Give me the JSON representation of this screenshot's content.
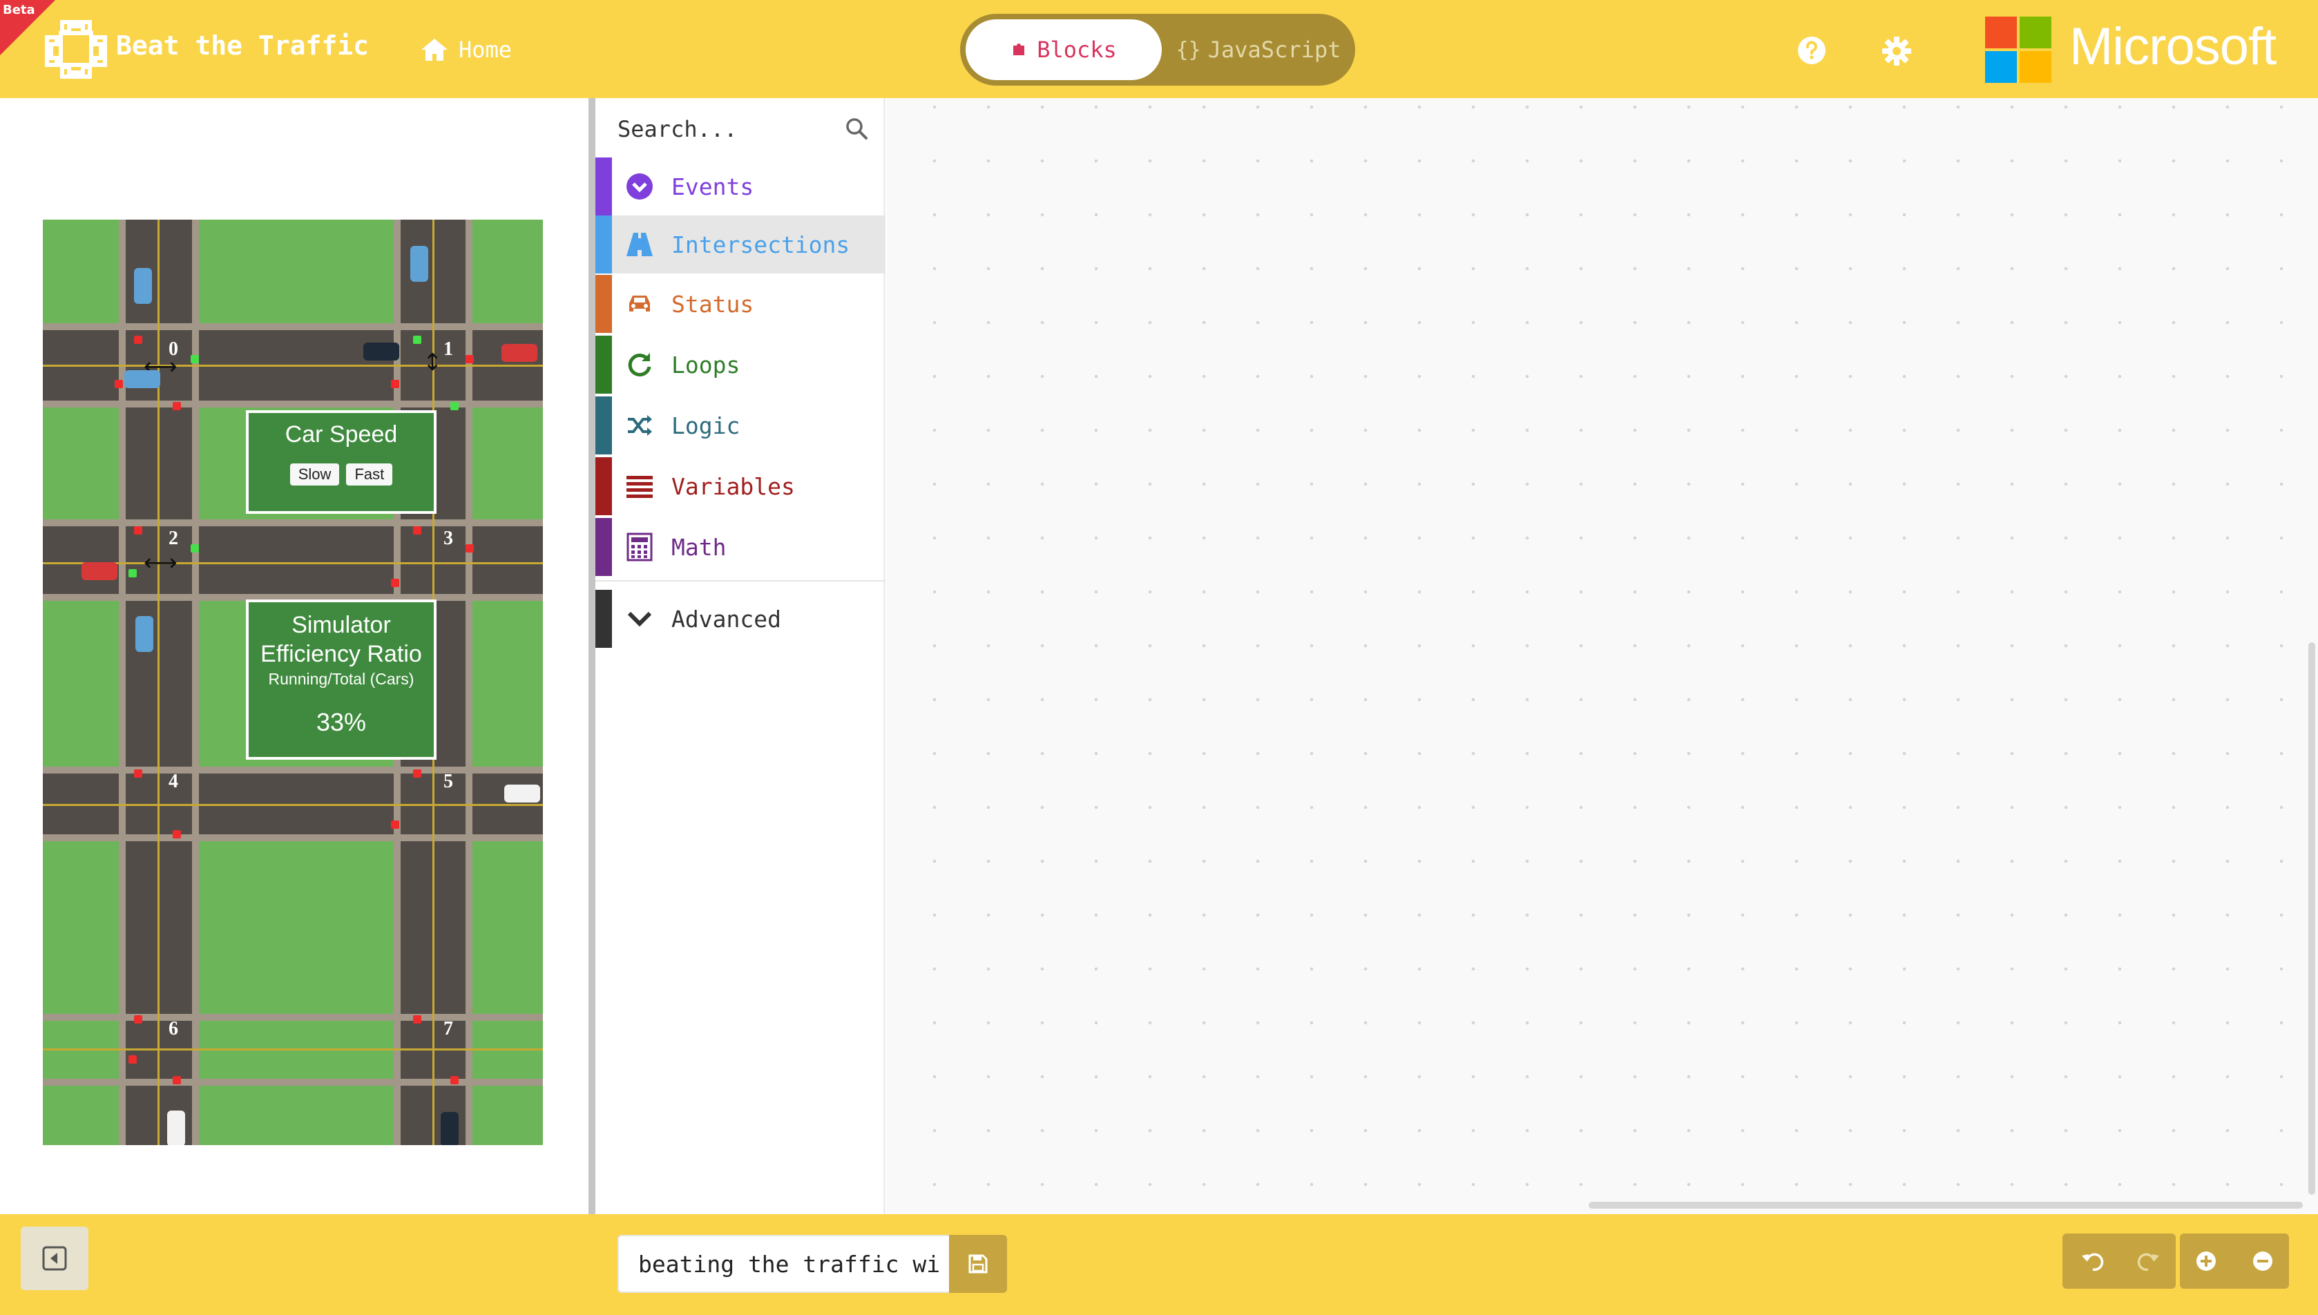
{
  "header": {
    "beta_badge": "Beta",
    "app_name": "Beat the Traffic",
    "home_label": "Home",
    "mode_blocks": "Blocks",
    "mode_js": "JavaScript",
    "brand_name": "Microsoft"
  },
  "simulator": {
    "speed_title": "Car Speed",
    "slow_label": "Slow",
    "fast_label": "Fast",
    "efficiency_title_1": "Simulator",
    "efficiency_title_2": "Efficiency Ratio",
    "efficiency_subtitle": "Running/Total (Cars)",
    "efficiency_value": "33%",
    "intersections": [
      "0",
      "1",
      "2",
      "3",
      "4",
      "5",
      "6",
      "7"
    ]
  },
  "toolbox": {
    "search_placeholder": "Search...",
    "categories": [
      {
        "label": "Events",
        "color": "#7e3fdc"
      },
      {
        "label": "Intersections",
        "color": "#4ba1e9"
      },
      {
        "label": "Status",
        "color": "#d46a2c"
      },
      {
        "label": "Loops",
        "color": "#2e7d26"
      },
      {
        "label": "Logic",
        "color": "#2b6b7c"
      },
      {
        "label": "Variables",
        "color": "#a11e1e"
      },
      {
        "label": "Math",
        "color": "#6f2b88"
      },
      {
        "label": "Advanced",
        "color": "#333333"
      }
    ]
  },
  "footer": {
    "project_name": "beating the traffic wi"
  }
}
